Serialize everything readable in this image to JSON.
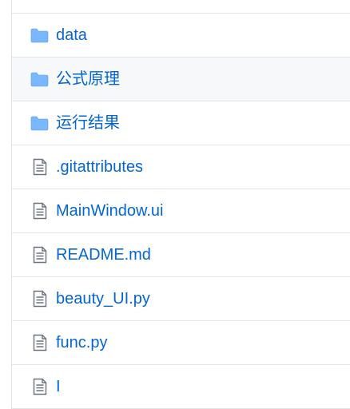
{
  "colors": {
    "link": "#0366d6",
    "folder_icon": "#79b8ff",
    "file_icon": "#6a737d",
    "row_border": "#e1e4e8",
    "hover_bg": "#f6f8fa"
  },
  "file_list": {
    "items": [
      {
        "type": "folder",
        "icon": "folder-icon",
        "name": "__"
      },
      {
        "type": "folder",
        "icon": "folder-icon",
        "name": "data"
      },
      {
        "type": "folder",
        "icon": "folder-icon",
        "name": "公式原理",
        "hovered": true
      },
      {
        "type": "folder",
        "icon": "folder-icon",
        "name": "运行结果"
      },
      {
        "type": "file",
        "icon": "file-icon",
        "name": ".gitattributes"
      },
      {
        "type": "file",
        "icon": "file-icon",
        "name": "MainWindow.ui"
      },
      {
        "type": "file",
        "icon": "file-icon",
        "name": "README.md"
      },
      {
        "type": "file",
        "icon": "file-icon",
        "name": "beauty_UI.py"
      },
      {
        "type": "file",
        "icon": "file-icon",
        "name": "func.py"
      },
      {
        "type": "file",
        "icon": "file-icon",
        "name": "I"
      }
    ]
  }
}
